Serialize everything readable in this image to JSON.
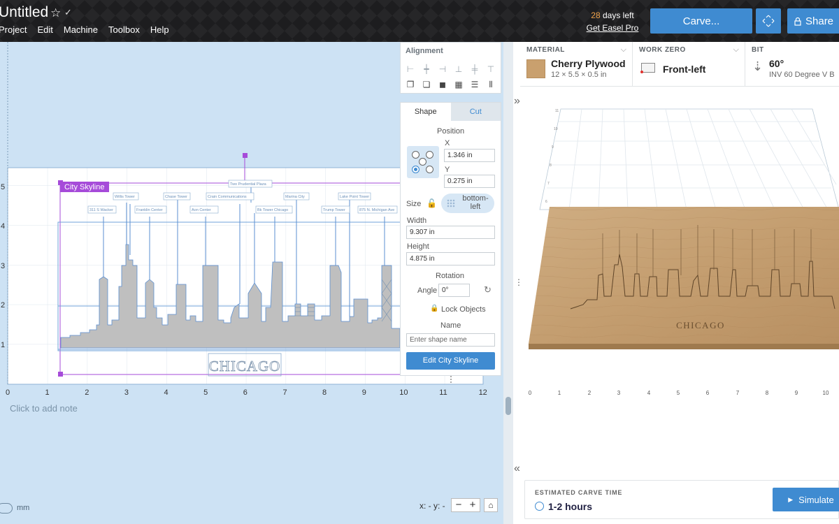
{
  "header": {
    "title": "Untitled",
    "menu": [
      "Project",
      "Edit",
      "Machine",
      "Toolbox",
      "Help"
    ],
    "trial_days": "28",
    "trial_suffix": " days left",
    "get_pro": "Get Easel Pro",
    "carve_label": "Carve...",
    "share_label": "Share"
  },
  "canvas": {
    "selection_label": "City Skyline",
    "chicago_text": "CHICAGO",
    "note_placeholder": "Click to add note",
    "x_ticks": [
      "0",
      "1",
      "2",
      "3",
      "4",
      "5",
      "6",
      "7",
      "8",
      "9",
      "10",
      "11",
      "12"
    ],
    "y_ticks": [
      "1",
      "2",
      "3",
      "4",
      "5"
    ],
    "units": "mm",
    "xy_readout": "x: -  y: -",
    "zoom_out": "−",
    "zoom_in": "+",
    "building_labels": [
      "311 S Wacker",
      "Willis Tower",
      "Franklin Center",
      "Chase Tower",
      "Aon Center",
      "Crain Communications",
      "Two Prudential Plaza",
      "Bk Tower Chicago",
      "Marina City",
      "Trump Tower",
      "Lake Point Tower",
      "875 N. Michigan Ave"
    ]
  },
  "alignment": {
    "title": "Alignment"
  },
  "shape_panel": {
    "tab_shape": "Shape",
    "tab_cut": "Cut",
    "position_label": "Position",
    "x_label": "X",
    "x_value": "1.346 in",
    "y_label": "Y",
    "y_value": "0.275 in",
    "size_label": "Size",
    "anchor_line1": "bottom-",
    "anchor_line2": "left",
    "width_label": "Width",
    "width_value": "9.307 in",
    "height_label": "Height",
    "height_value": "4.875 in",
    "rotation_label": "Rotation",
    "angle_label": "Angle",
    "angle_value": "0°",
    "lock_label": "Lock Objects",
    "name_label": "Name",
    "name_placeholder": "Enter shape name",
    "edit_button": "Edit City Skyline"
  },
  "material": {
    "label": "MATERIAL",
    "name": "Cherry Plywood",
    "dims": "12 × 5.5 × 0.5 in",
    "swatch_color": "#c9a06e"
  },
  "work_zero": {
    "label": "WORK ZERO",
    "value": "Front-left"
  },
  "bit": {
    "label": "BIT",
    "angle": "60°",
    "desc": "INV 60 Degree V B"
  },
  "preview": {
    "x_ticks": [
      "0",
      "1",
      "2",
      "3",
      "4",
      "5",
      "6",
      "7",
      "8",
      "9",
      "10"
    ],
    "y_ticks": [
      "11",
      "10",
      "9",
      "8",
      "7",
      "6",
      "5",
      "4",
      "3",
      "2",
      "1"
    ],
    "engraved_text": "CHICAGO"
  },
  "estimate": {
    "label": "ESTIMATED CARVE TIME",
    "value": "1-2 hours",
    "simulate": "Simulate"
  },
  "colors": {
    "accent": "#3f8bd1",
    "selection": "#a64bd9",
    "wood": "#c9a06e"
  }
}
